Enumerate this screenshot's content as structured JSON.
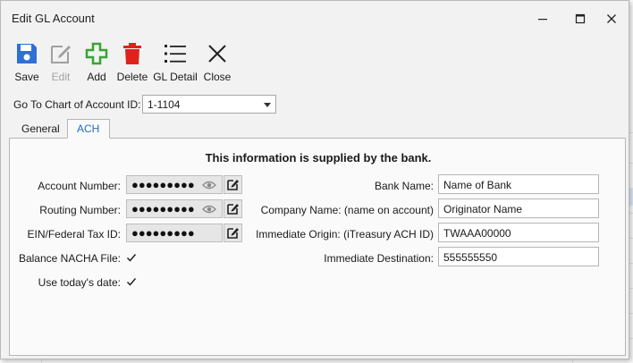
{
  "window": {
    "title": "Edit GL Account"
  },
  "toolbar": {
    "save": "Save",
    "edit": "Edit",
    "add": "Add",
    "delete": "Delete",
    "gl_detail": "GL Detail",
    "close": "Close"
  },
  "goto": {
    "label": "Go To Chart of Account ID:",
    "value": "1-1104"
  },
  "tabs": {
    "general": "General",
    "ach": "ACH",
    "active": "ACH"
  },
  "ach": {
    "heading": "This information is supplied by the bank.",
    "account_number_label": "Account Number:",
    "account_number_value": "●●●●●●●●●",
    "routing_number_label": "Routing Number:",
    "routing_number_value": "●●●●●●●●●",
    "ein_label": "EIN/Federal Tax ID:",
    "ein_value": "●●●●●●●●●",
    "balance_nacha_label": "Balance NACHA File:",
    "balance_nacha_checked": true,
    "use_today_label": "Use today's date:",
    "use_today_checked": true,
    "bank_name_label": "Bank Name:",
    "bank_name_value": "Name of Bank",
    "company_name_label": "Company Name: (name on account)",
    "company_name_value": "Originator Name",
    "immediate_origin_label": "Immediate Origin: (iTreasury ACH ID)",
    "immediate_origin_value": "TWAAA00000",
    "immediate_destination_label": "Immediate Destination:",
    "immediate_destination_value": "555555550"
  },
  "colors": {
    "accent": "#1f6fbf",
    "save_blue": "#2f6fd6",
    "add_green": "#3aa335",
    "delete_red": "#e0221d"
  }
}
